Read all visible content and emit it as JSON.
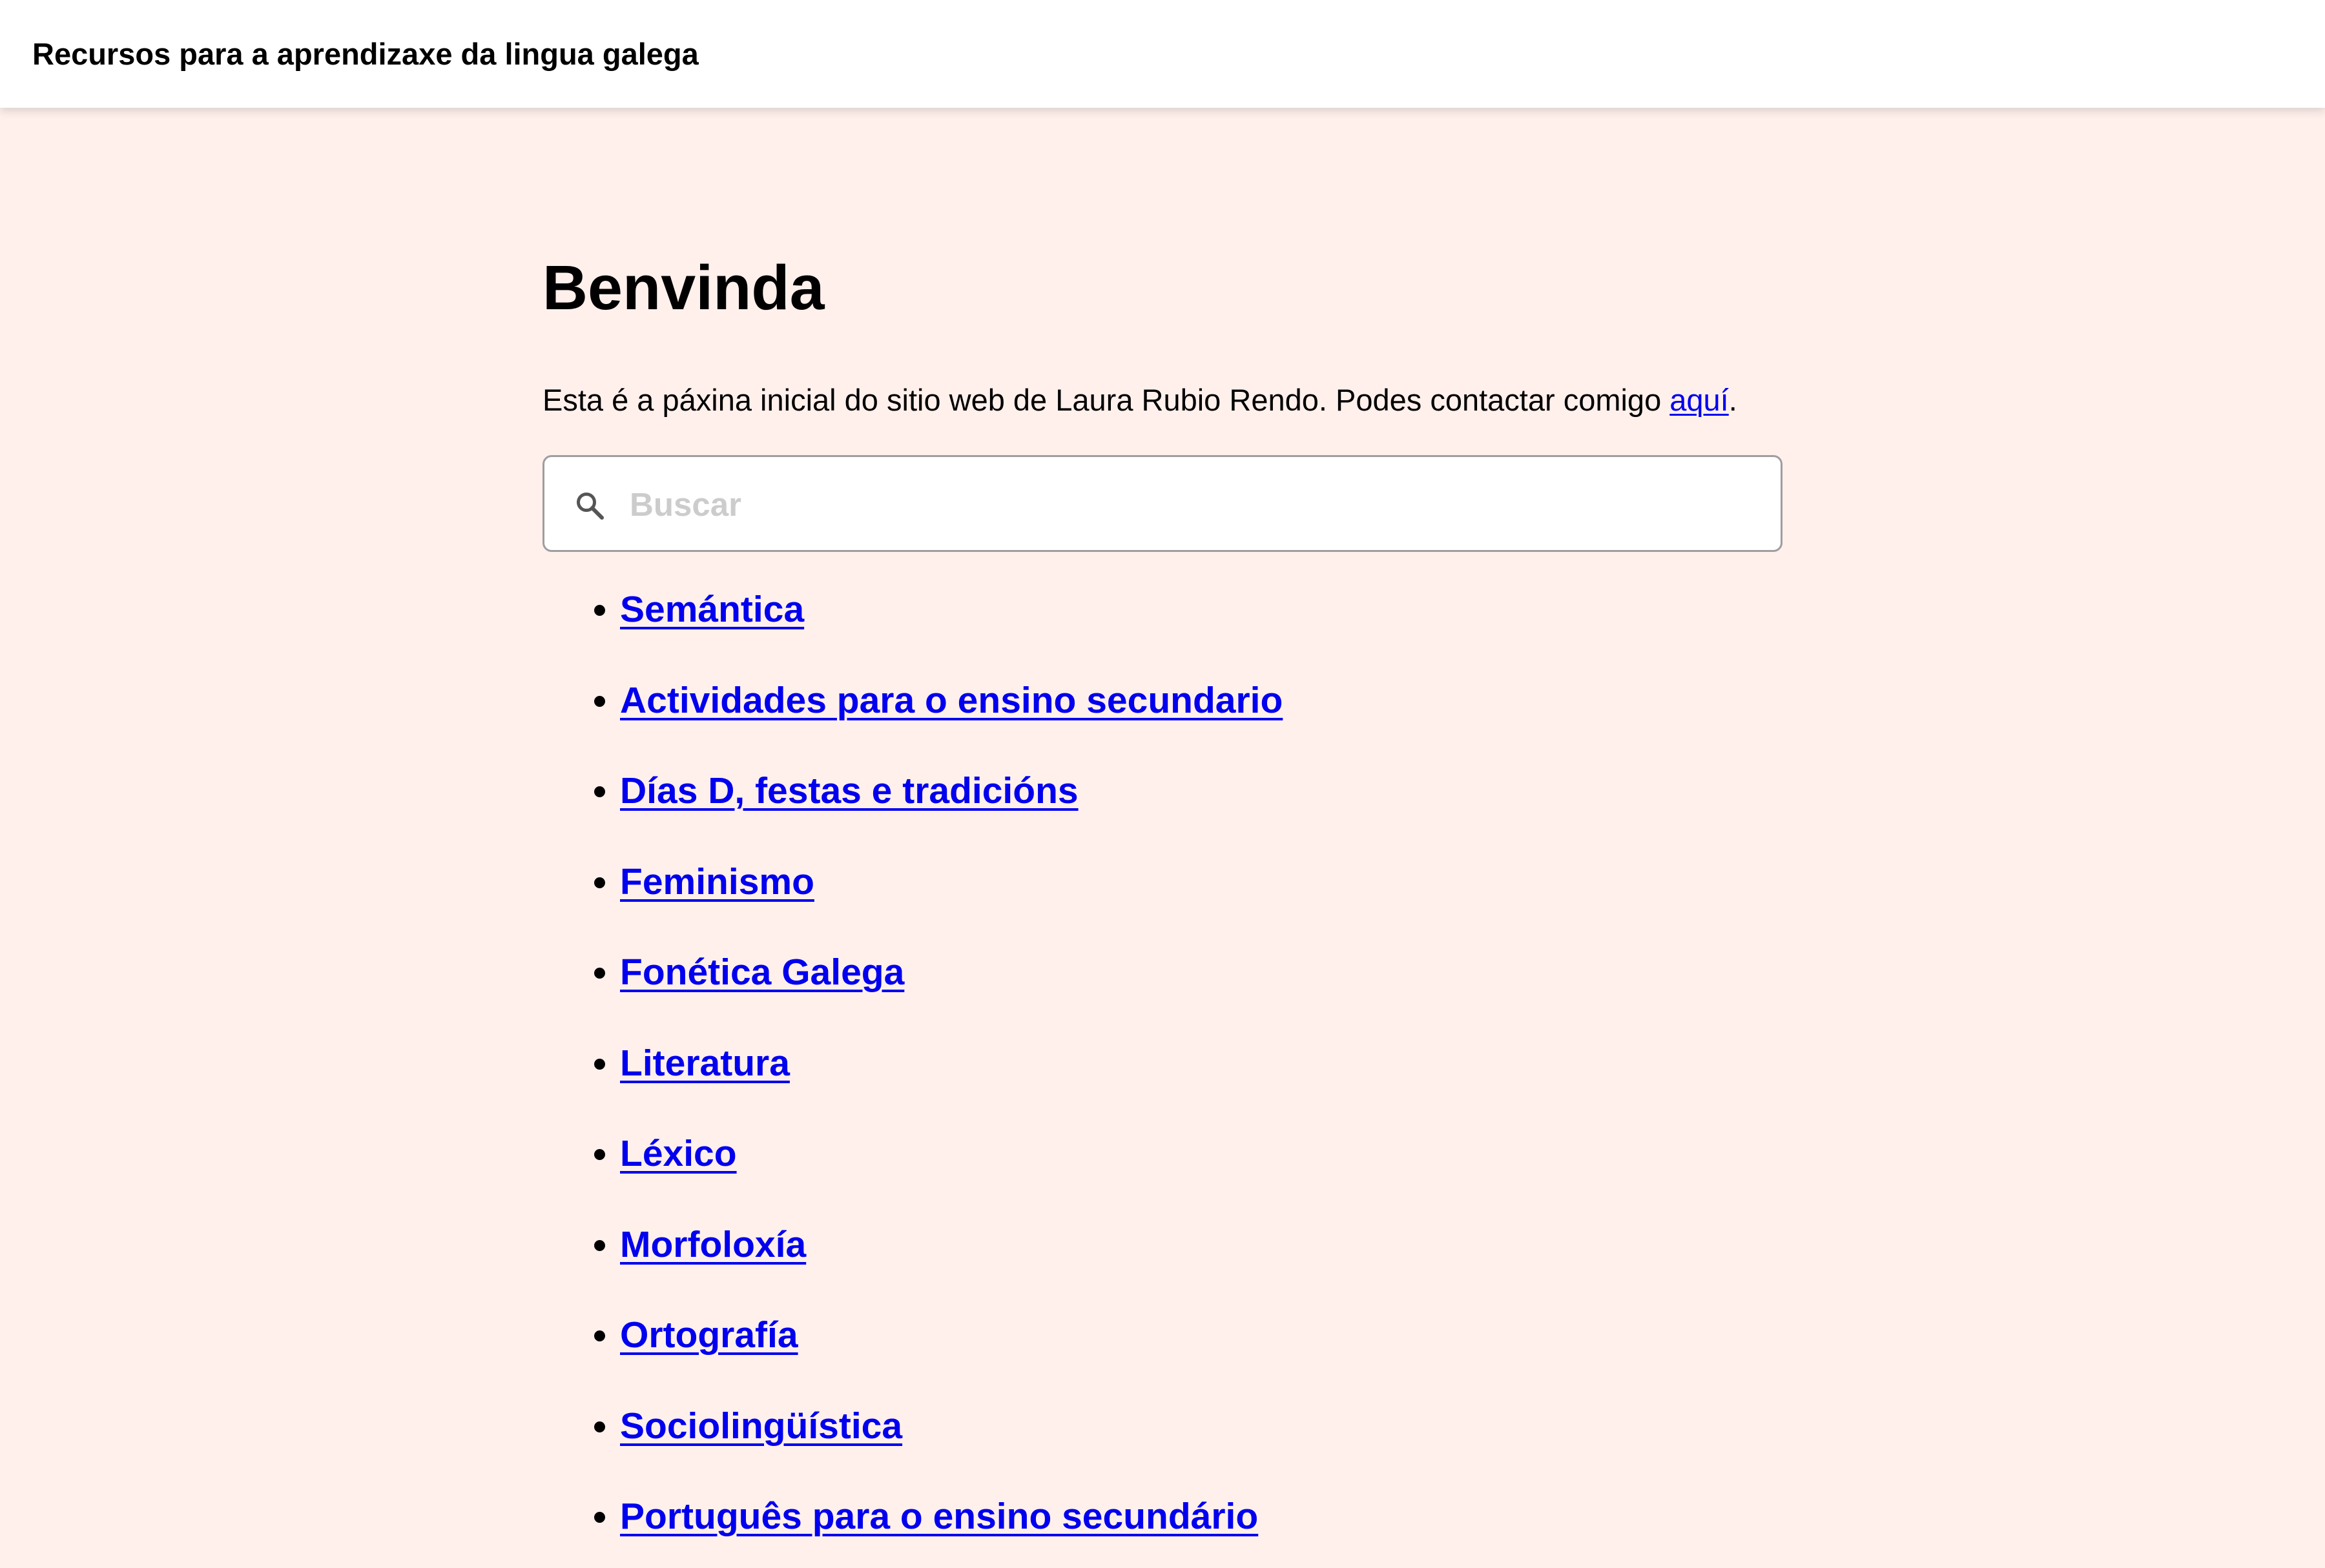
{
  "header": {
    "site_title": "Recursos para a aprendizaxe da lingua galega"
  },
  "main": {
    "title": "Benvinda",
    "intro_text": "Esta é a páxina inicial do sitio web de Laura Rubio Rendo. Podes contactar comigo ",
    "contact_link": "aquí",
    "intro_end": "."
  },
  "search": {
    "placeholder": "Buscar",
    "value": "",
    "icon": "search-icon"
  },
  "topics": [
    {
      "label": "Semántica"
    },
    {
      "label": "Actividades para o ensino secundario"
    },
    {
      "label": "Días D, festas e tradicións"
    },
    {
      "label": "Feminismo"
    },
    {
      "label": "Fonética Galega"
    },
    {
      "label": "Literatura"
    },
    {
      "label": "Léxico"
    },
    {
      "label": "Morfoloxía"
    },
    {
      "label": "Ortografía"
    },
    {
      "label": "Sociolingüística"
    },
    {
      "label": "Português para o ensino secundário"
    }
  ],
  "colors": {
    "background": "#fff0ec",
    "header_background": "#ffffff",
    "link": "#0000ee",
    "text": "#000000",
    "placeholder": "#cccccc",
    "search_border": "#9e9e9e"
  }
}
